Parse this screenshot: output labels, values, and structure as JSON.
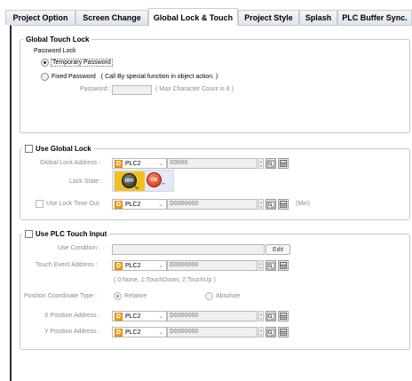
{
  "tabs": [
    {
      "label": "Project Option"
    },
    {
      "label": "Screen Change"
    },
    {
      "label": "Global Lock & Touch"
    },
    {
      "label": "Project Style"
    },
    {
      "label": "Splash"
    },
    {
      "label": "PLC Buffer Sync."
    }
  ],
  "global_touch_lock": {
    "title": "Global Touch Lock",
    "password_lock_label": "Password Lock",
    "temporary_password_label": "Temporary Password",
    "fixed_password_label": "Fixed Password",
    "fixed_password_note": "( Call By special function in object action. )",
    "password_label": "Password :",
    "password_hint": "( Max Character Count is 8 )",
    "selected": "Temporary Password"
  },
  "global_lock": {
    "title": "Use Global Lock",
    "checked": false,
    "address_label": "Global Lock Address :",
    "address_plc": "PLC2",
    "address_value": "X0000",
    "lock_state_label": "Lock State :",
    "off_label": "OFF",
    "on_label": "ON",
    "timeout_label": "Use Lock Time Out",
    "timeout_plc": "PLC2",
    "timeout_value": "D0000000",
    "timeout_unit": "(Min)"
  },
  "plc_touch_input": {
    "title": "Use PLC Touch Input",
    "checked": false,
    "use_condition_label": "Use Condition :",
    "edit_label": "Edit",
    "touch_event_label": "Touch Event Address :",
    "touch_event_plc": "PLC2",
    "touch_event_value": "D0000000",
    "touch_event_hint": "( 0:None, 1:TouchDown, 2:TouchUp )",
    "position_type_label": "Position Coordinate Type :",
    "relative_label": "Relative",
    "absolute_label": "Absolute",
    "position_selected": "Relative",
    "x_label": "X Position Address :",
    "x_plc": "PLC2",
    "x_value": "D0000000",
    "y_label": "Y Position Address :",
    "y_plc": "PLC2",
    "y_value": "D0000000"
  },
  "icons": {
    "plc_badge": "D",
    "address_browse": "address-browse-icon",
    "keypad": "keypad-icon"
  },
  "colors": {
    "plc_badge": "#f0a020",
    "tab_border": "#c6ccd6",
    "disabled_text": "#8a8a8a"
  }
}
